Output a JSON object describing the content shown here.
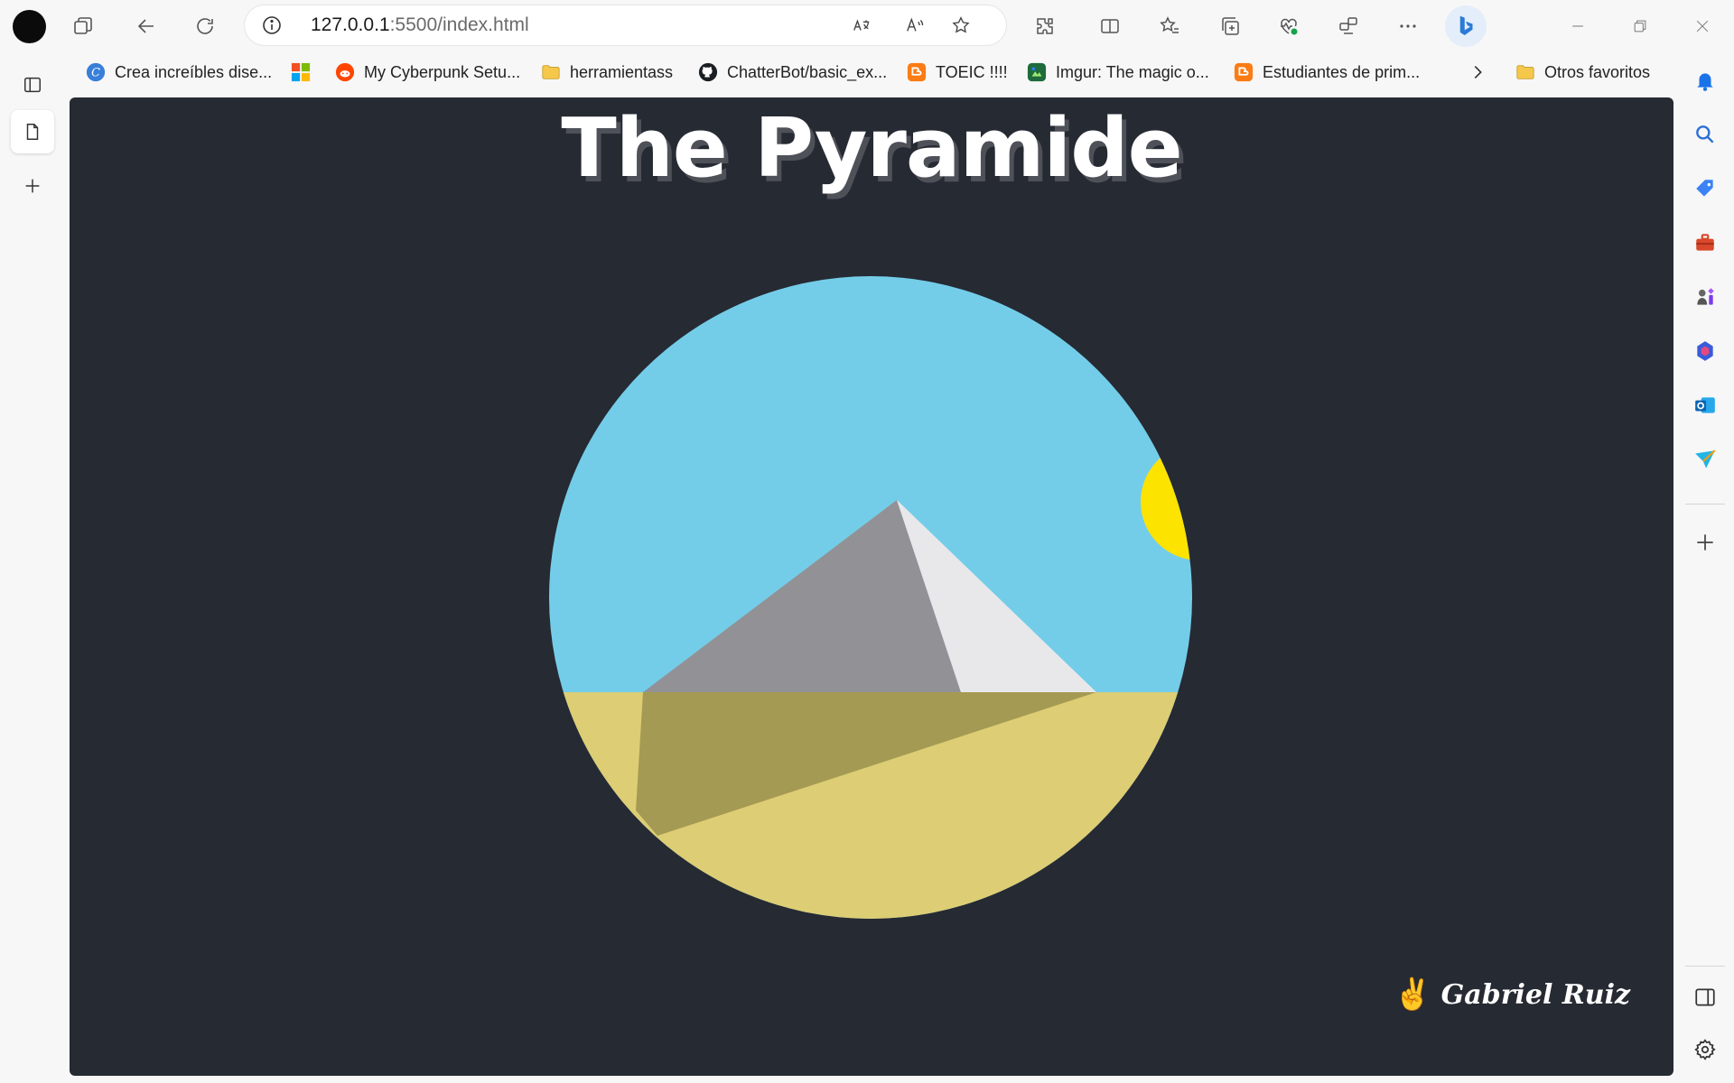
{
  "browser": {
    "address": {
      "host": "127.0.0.1",
      "path": ":5500/index.html"
    },
    "bookmarks": [
      {
        "label": "Crea increíbles dise...",
        "icon": "canva-icon"
      },
      {
        "label": "",
        "icon": "microsoft-icon"
      },
      {
        "label": "My Cyberpunk Setu...",
        "icon": "reddit-icon"
      },
      {
        "label": "herramientass",
        "icon": "folder-icon"
      },
      {
        "label": "ChatterBot/basic_ex...",
        "icon": "github-icon"
      },
      {
        "label": "TOEIC !!!!",
        "icon": "blogger-icon"
      },
      {
        "label": "Imgur: The magic o...",
        "icon": "imgur-icon"
      },
      {
        "label": "Estudiantes de prim...",
        "icon": "blogger-icon"
      }
    ],
    "other_favorites": "Otros favoritos"
  },
  "page": {
    "title": "The Pyramide",
    "author": "Gabriel Ruiz",
    "author_emoji": "✌️",
    "colors": {
      "background": "#262a33",
      "sky": "#74cde8",
      "sun": "#fde300",
      "pyramid_shadow_side": "#929296",
      "pyramid_lit_side": "#e8e8ea",
      "sand": "#ddcd74",
      "sand_shadow": "#a59a53"
    }
  }
}
